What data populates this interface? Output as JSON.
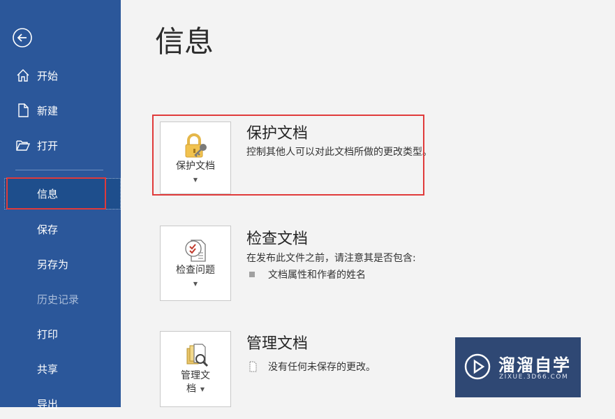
{
  "colors": {
    "sidebar_bg": "#2b579a",
    "selected_bg": "#1e4e8c",
    "highlight_outline": "#e03a3a",
    "content_bg": "#f3f3f3"
  },
  "sidebar": {
    "back_icon": "back-arrow-icon",
    "items": [
      {
        "label": "开始",
        "icon": "home-icon"
      },
      {
        "label": "新建",
        "icon": "new-document-icon"
      },
      {
        "label": "打开",
        "icon": "open-folder-icon"
      },
      {
        "label": "信息",
        "selected": true
      },
      {
        "label": "保存"
      },
      {
        "label": "另存为"
      },
      {
        "label": "历史记录",
        "disabled": true
      },
      {
        "label": "打印"
      },
      {
        "label": "共享"
      },
      {
        "label": "导出"
      }
    ]
  },
  "main": {
    "title": "信息",
    "sections": [
      {
        "button_label": "保护文档",
        "icon": "lock-key-icon",
        "title": "保护文档",
        "description": "控制其他人可以对此文档所做的更改类型。"
      },
      {
        "button_label": "检查问题",
        "icon": "inspect-document-icon",
        "title": "检查文档",
        "description": "在发布此文件之前，请注意其是否包含:",
        "bullets": [
          "文档属性和作者的姓名"
        ]
      },
      {
        "button_label_line1": "管理文",
        "button_label_line2": "档",
        "icon": "manage-document-icon",
        "title": "管理文档",
        "description": "没有任何未保存的更改。"
      }
    ]
  },
  "watermark": {
    "text": "溜溜自学",
    "sub": "ZIXUE.3D66.COM"
  }
}
